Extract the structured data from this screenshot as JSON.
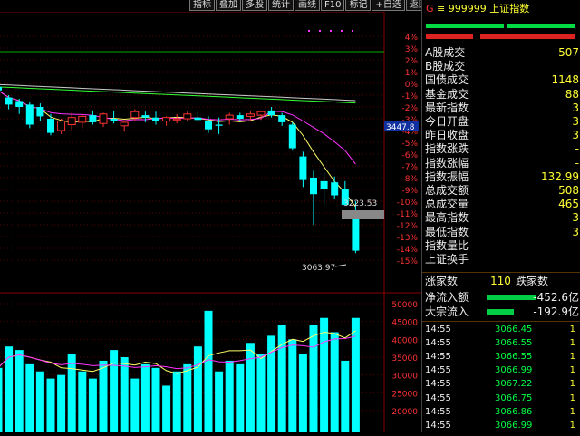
{
  "toolbar": {
    "items": [
      "指标",
      "叠加",
      "多股",
      "统计",
      "画线",
      "F10",
      "标记",
      "+自选",
      "返回"
    ]
  },
  "chart_data": {
    "type": "candlestick",
    "price_axis_labels": [
      "4%",
      "3%",
      "2%",
      "1%",
      "0%",
      "-1%",
      "-2%",
      "-3%",
      "-4%",
      "-5%",
      "-6%",
      "-7%",
      "-8%",
      "-9%",
      "-10%",
      "-11%",
      "-12%",
      "-13%",
      "-14%",
      "-15%"
    ],
    "volume_axis_labels": [
      "50000",
      "45000",
      "40000",
      "35000",
      "30000",
      "25000",
      "20000"
    ],
    "current_price_tag": "3447.8",
    "annotation_high": "3223.53",
    "annotation_low": "3063.97",
    "candles_pct": [
      [
        -0.3,
        -0.1,
        -1.1,
        -0.6
      ],
      [
        -1.2,
        -1.0,
        -2.2,
        -1.8
      ],
      [
        -1.5,
        -1.3,
        -2.6,
        -2.0
      ],
      [
        -1.8,
        -1.6,
        -3.8,
        -3.5
      ],
      [
        -2.0,
        -1.7,
        -3.2,
        -2.8
      ],
      [
        -3.0,
        -2.6,
        -4.4,
        -4.2
      ],
      [
        -4.0,
        -3.0,
        -4.3,
        -3.2
      ],
      [
        -3.5,
        -2.5,
        -4.0,
        -2.9
      ],
      [
        -3.3,
        -2.6,
        -3.8,
        -2.8
      ],
      [
        -2.7,
        -2.3,
        -3.5,
        -3.3
      ],
      [
        -3.4,
        -2.5,
        -3.7,
        -2.6
      ],
      [
        -3.0,
        -2.3,
        -3.4,
        -3.2
      ],
      [
        -3.6,
        -3.2,
        -4.1,
        -3.3
      ],
      [
        -2.9,
        -2.2,
        -3.2,
        -2.4
      ],
      [
        -2.7,
        -2.4,
        -3.3,
        -2.9
      ],
      [
        -2.9,
        -2.4,
        -3.5,
        -3.2
      ],
      [
        -3.2,
        -2.8,
        -3.6,
        -2.9
      ],
      [
        -3.1,
        -2.6,
        -3.4,
        -3.0
      ],
      [
        -3.0,
        -2.4,
        -3.2,
        -2.6
      ],
      [
        -2.9,
        -2.4,
        -3.3,
        -3.1
      ],
      [
        -3.2,
        -2.8,
        -4.2,
        -3.9
      ],
      [
        -3.5,
        -2.9,
        -4.3,
        -3.6
      ],
      [
        -3.0,
        -2.5,
        -3.5,
        -2.7
      ],
      [
        -2.7,
        -2.5,
        -3.2,
        -3.0
      ],
      [
        -2.8,
        -2.4,
        -3.2,
        -2.6
      ],
      [
        -2.7,
        -2.3,
        -3.1,
        -2.4
      ],
      [
        -2.3,
        -2.0,
        -2.9,
        -2.7
      ],
      [
        -2.7,
        -2.5,
        -3.6,
        -3.3
      ],
      [
        -3.5,
        -3.3,
        -5.7,
        -5.5
      ],
      [
        -6.2,
        -5.8,
        -8.8,
        -8.2
      ],
      [
        -8.0,
        -7.4,
        -12.0,
        -9.4
      ],
      [
        -8.3,
        -7.6,
        -10.3,
        -9.0
      ],
      [
        -8.4,
        -7.9,
        -9.8,
        -9.5
      ],
      [
        -9.0,
        -8.3,
        -10.2,
        -10.3
      ],
      [
        -10.8,
        -10.0,
        -14.4,
        -14.2
      ]
    ],
    "volumes": [
      32000,
      38000,
      37000,
      33000,
      31000,
      29000,
      30000,
      36000,
      31000,
      29000,
      34000,
      37000,
      35000,
      29000,
      33000,
      32000,
      27000,
      31000,
      33000,
      38000,
      48000,
      31000,
      34000,
      33000,
      39000,
      36000,
      41000,
      44000,
      40000,
      36000,
      44000,
      46000,
      42000,
      34000,
      46000
    ]
  },
  "panel": {
    "title_prefix": "G",
    "title_sep": "≡",
    "code": "999999",
    "name": "上证指数",
    "rows": [
      {
        "label": "A股成交",
        "value": "507"
      },
      {
        "label": "B股成交",
        "value": ""
      },
      {
        "label": "国债成交",
        "value": "1148"
      },
      {
        "label": "基金成交",
        "value": "88"
      },
      {
        "label": "最新指数",
        "value": "3"
      },
      {
        "label": "今日开盘",
        "value": "3"
      },
      {
        "label": "昨日收盘",
        "value": "3"
      },
      {
        "label": "指数涨跌",
        "value": "-"
      },
      {
        "label": "指数涨幅",
        "value": "-"
      },
      {
        "label": "指数振幅",
        "value": "132.99"
      },
      {
        "label": "总成交额",
        "value": "508"
      },
      {
        "label": "总成交量",
        "value": "465"
      },
      {
        "label": "最高指数",
        "value": "3"
      },
      {
        "label": "最低指数",
        "value": "3"
      },
      {
        "label": "指数量比",
        "value": ""
      },
      {
        "label": "上证换手",
        "value": ""
      }
    ],
    "breadth": {
      "up_label": "涨家数",
      "up_value": "",
      "count": "110",
      "down_label": "跌家数"
    },
    "flow": [
      {
        "label": "净流入额",
        "value": "-452.6亿"
      },
      {
        "label": "大宗流入",
        "value": "-192.9亿"
      }
    ],
    "ticks": [
      {
        "time": "14:55",
        "price": "3066.45",
        "vol": "1"
      },
      {
        "time": "14:55",
        "price": "3066.55",
        "vol": "1"
      },
      {
        "time": "14:55",
        "price": "3066.55",
        "vol": "1"
      },
      {
        "time": "14:55",
        "price": "3066.99",
        "vol": "1"
      },
      {
        "time": "14:55",
        "price": "3067.22",
        "vol": "1"
      },
      {
        "time": "14:55",
        "price": "3066.75",
        "vol": "1"
      },
      {
        "time": "14:55",
        "price": "3066.86",
        "vol": "1"
      },
      {
        "time": "14:55",
        "price": "3066.99",
        "vol": "1"
      }
    ],
    "colors": {
      "up": "#ff3333",
      "down": "#00ffff",
      "ma5": "#ffff66",
      "ma10": "#ff33ff",
      "ma20": "#33ff33",
      "ma60": "#cccccc",
      "flow_bar": "#00cc44"
    }
  }
}
